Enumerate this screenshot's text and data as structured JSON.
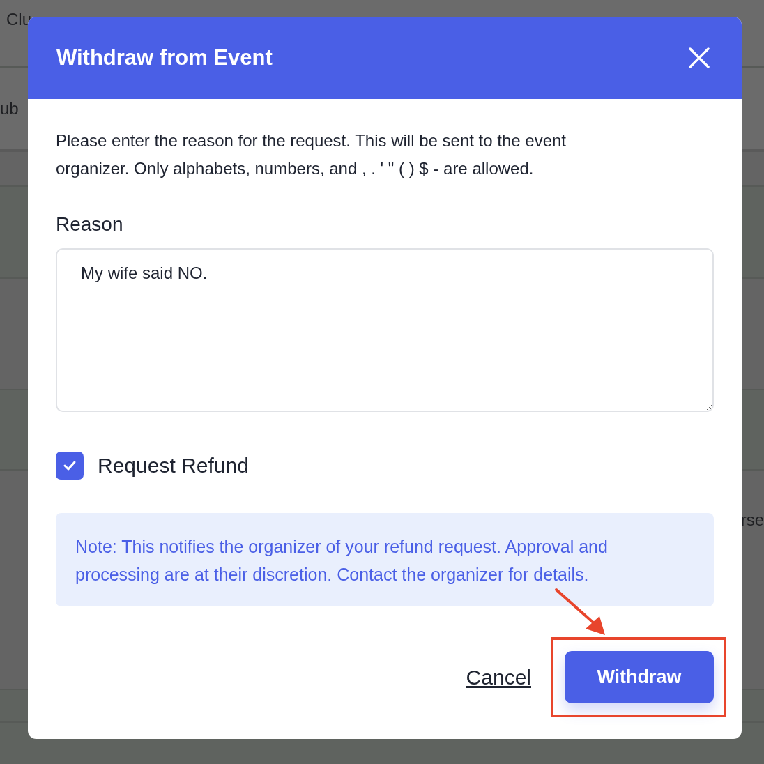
{
  "background": {
    "texts": [
      "Clu",
      "ub",
      "rse"
    ]
  },
  "dialog": {
    "title": "Withdraw from Event",
    "instructions": "Please enter the reason for the request. This will be sent to the event organizer. Only alphabets, numbers, and , . ' \" ( ) $ - are allowed.",
    "reason": {
      "label": "Reason",
      "value": "My wife said NO."
    },
    "refund": {
      "label": "Request Refund",
      "checked": true
    },
    "note": "Note: This notifies the organizer of your refund request. Approval and processing are at their discretion. Contact the organizer for details.",
    "buttons": [
      {
        "label": "Cancel",
        "kind": "link",
        "highlighted": false
      },
      {
        "label": "Withdraw",
        "kind": "primary",
        "highlighted": true
      }
    ]
  }
}
